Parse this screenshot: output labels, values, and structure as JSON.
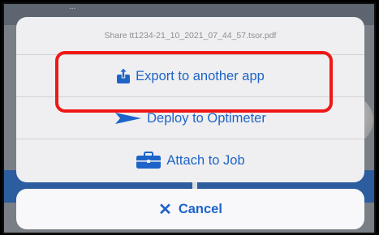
{
  "background": {
    "top_text": "...",
    "colors": {
      "top": "#5d6670",
      "panel": "#2c5d9e"
    }
  },
  "share_sheet": {
    "title": "Share tt1234-21_10_2021_07_44_57.tsor.pdf",
    "actions": [
      {
        "label": "Export to another app",
        "icon": "share-upload-icon",
        "highlighted": true
      },
      {
        "label": "Deploy to Optimeter",
        "icon": "send-arrow-icon",
        "highlighted": false
      },
      {
        "label": "Attach to Job",
        "icon": "briefcase-icon",
        "highlighted": false
      }
    ],
    "cancel": {
      "label": "Cancel",
      "icon": "close-icon"
    }
  },
  "colors": {
    "accent": "#1e64c8",
    "highlight": "#f01717",
    "sheet": "#efeff1",
    "muted_text": "#8e8e93"
  }
}
